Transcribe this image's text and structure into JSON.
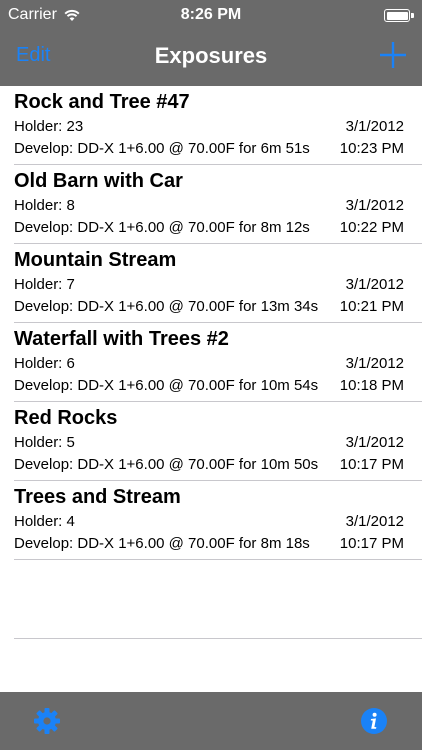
{
  "status_bar": {
    "carrier": "Carrier",
    "time": "8:26 PM",
    "icons": [
      "wifi-icon",
      "battery-icon"
    ]
  },
  "nav": {
    "edit_label": "Edit",
    "title": "Exposures",
    "add_icon": "plus-icon"
  },
  "exposures": [
    {
      "title": "Rock and Tree #47",
      "holder": "Holder: 23",
      "date": "3/1/2012",
      "develop": "Develop: DD-X 1+6.00 @ 70.00F for 6m 51s",
      "time": "10:23 PM"
    },
    {
      "title": "Old Barn with Car",
      "holder": "Holder: 8",
      "date": "3/1/2012",
      "develop": "Develop: DD-X 1+6.00 @ 70.00F for 8m 12s",
      "time": "10:22 PM"
    },
    {
      "title": "Mountain Stream",
      "holder": "Holder: 7",
      "date": "3/1/2012",
      "develop": "Develop: DD-X 1+6.00 @ 70.00F for 13m 34s",
      "time": "10:21 PM"
    },
    {
      "title": "Waterfall with Trees #2",
      "holder": "Holder: 6",
      "date": "3/1/2012",
      "develop": "Develop: DD-X 1+6.00 @ 70.00F for 10m 54s",
      "time": "10:18 PM"
    },
    {
      "title": "Red Rocks",
      "holder": "Holder: 5",
      "date": "3/1/2012",
      "develop": "Develop: DD-X 1+6.00 @ 70.00F for 10m 50s",
      "time": "10:17 PM"
    },
    {
      "title": "Trees and Stream",
      "holder": "Holder: 4",
      "date": "3/1/2012",
      "develop": "Develop: DD-X 1+6.00 @ 70.00F for 8m 18s",
      "time": "10:17 PM"
    }
  ],
  "toolbar": {
    "left_icon": "gear-icon",
    "right_icon": "info-icon"
  },
  "colors": {
    "bar_background": "#6a6a6a",
    "accent": "#1a82f7",
    "separator": "#c8c7cc"
  }
}
